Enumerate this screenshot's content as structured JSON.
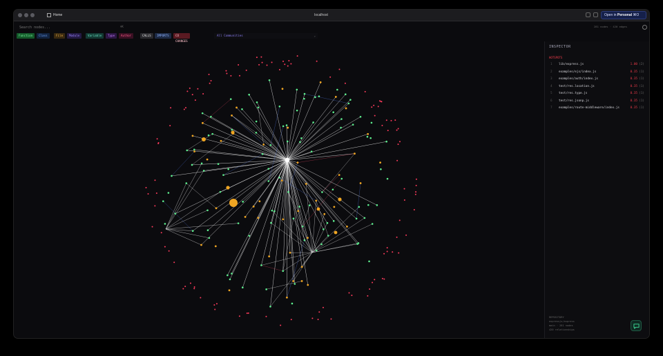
{
  "browser": {
    "tab_title": "Home",
    "url": "localhost",
    "open_button_prefix": "Open in",
    "open_button_profile": "Personal",
    "open_button_shortcut": "⌘O"
  },
  "toolbar": {
    "search_placeholder": "Search nodes...",
    "search_shortcut": "⌘K",
    "filters": [
      {
        "label": "Function",
        "bg": "#145a2a",
        "fg": "#7cf2a0"
      },
      {
        "label": "Class",
        "bg": "#12233f",
        "fg": "#6fa4ff"
      },
      {
        "label": "File",
        "bg": "#3a2a10",
        "fg": "#f0b447"
      },
      {
        "label": "Module",
        "bg": "#241a44",
        "fg": "#9b84ff"
      },
      {
        "label": "Variable",
        "bg": "#133a33",
        "fg": "#6be3c5"
      },
      {
        "label": "Type",
        "bg": "#2d1645",
        "fg": "#c77dff"
      },
      {
        "label": "Author",
        "bg": "#3a1023",
        "fg": "#ff5c8a"
      }
    ],
    "edge_filters": [
      {
        "label": "CALLS",
        "bg": "#2a2a2e",
        "fg": "#e6e6e6"
      },
      {
        "label": "IMPORTS",
        "bg": "#1d2a44",
        "fg": "#8fb2ff"
      },
      {
        "label": "CO CHANGES",
        "bg": "#5a1a22",
        "fg": "#ffc0c8"
      }
    ],
    "community_select": "All Communities",
    "stats": "281 nodes · 420 edges"
  },
  "inspector": {
    "title": "INSPECTOR",
    "hotspots_label": "HOTSPOTS",
    "hotspots": [
      {
        "rank": "1",
        "path": "lib/express.js",
        "score": "1.00",
        "count": "(2)"
      },
      {
        "rank": "2",
        "path": "examples/ejs/index.js",
        "score": "0.35",
        "count": "(1)"
      },
      {
        "rank": "3",
        "path": "examples/auth/index.js",
        "score": "0.35",
        "count": "(1)"
      },
      {
        "rank": "4",
        "path": "test/res.location.js",
        "score": "0.35",
        "count": "(1)"
      },
      {
        "rank": "5",
        "path": "test/res.type.js",
        "score": "0.35",
        "count": "(1)"
      },
      {
        "rank": "6",
        "path": "test/res.jsonp.js",
        "score": "0.35",
        "count": "(1)"
      },
      {
        "rank": "7",
        "path": "examples/route-middleware/index.js",
        "score": "0.35",
        "count": "(1)"
      }
    ],
    "footer": [
      "REPOSITORY",
      "expressjs/express",
      "main · 281 nodes",
      "420 relationships"
    ]
  },
  "graph": {
    "colors": {
      "function": "#5ef08f",
      "file": "#f0a623",
      "author": "#ff3b5c",
      "edge_calls": "#f2f2f2",
      "edge_imports": "#4b6fd6",
      "edge_cochange": "#d0405a"
    }
  }
}
